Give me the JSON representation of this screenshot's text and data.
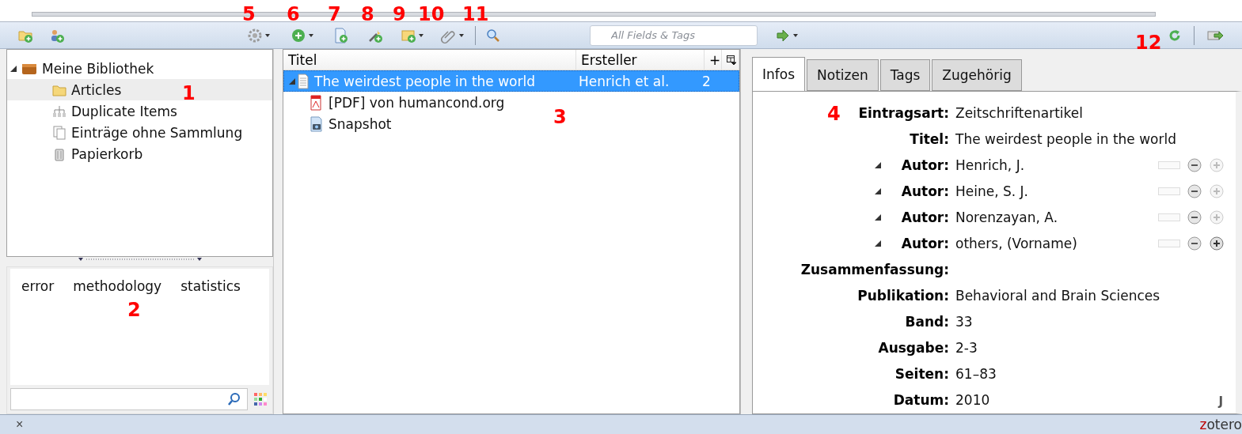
{
  "toolbar": {
    "search": {
      "placeholder": "All Fields & Tags"
    }
  },
  "collections": [
    {
      "label": "Meine Bibliothek",
      "kind": "library",
      "expanded": true,
      "selected": false,
      "children": [
        {
          "label": "Articles",
          "kind": "folder",
          "selected": true
        },
        {
          "label": "Duplicate Items",
          "kind": "duplicates",
          "selected": false
        },
        {
          "label": "Einträge ohne Sammlung",
          "kind": "unfiled",
          "selected": false
        },
        {
          "label": "Papierkorb",
          "kind": "trash",
          "selected": false
        }
      ]
    }
  ],
  "tags": [
    "error",
    "methodology",
    "statistics"
  ],
  "items": {
    "columns": [
      "Titel",
      "Ersteller",
      "+"
    ],
    "rows": [
      {
        "title": "The weirdest people in the world",
        "creator": "Henrich et al.",
        "column_3": "2",
        "kind": "article",
        "expanded": true,
        "selected": true,
        "children": [
          {
            "title": "[PDF] von humancond.org",
            "kind": "pdf",
            "selected": false
          },
          {
            "title": "Snapshot",
            "kind": "snapshot",
            "selected": false
          }
        ]
      }
    ]
  },
  "tabs": [
    {
      "label": "Infos",
      "selected": true
    },
    {
      "label": "Notizen",
      "selected": false
    },
    {
      "label": "Tags",
      "selected": false
    },
    {
      "label": "Zugehörig",
      "selected": false
    }
  ],
  "fields": [
    {
      "label": "Eintragsart:",
      "value": "Zeitschriftenartikel",
      "kind": "plain"
    },
    {
      "label": "Titel:",
      "value": "The weirdest people in the world",
      "kind": "plain"
    },
    {
      "label": "Autor:",
      "value": "Henrich, J.",
      "kind": "creator",
      "add_enabled": false
    },
    {
      "label": "Autor:",
      "value": "Heine, S. J.",
      "kind": "creator",
      "add_enabled": false
    },
    {
      "label": "Autor:",
      "value": "Norenzayan, A.",
      "kind": "creator",
      "add_enabled": false
    },
    {
      "label": "Autor:",
      "value": "others, (Vorname)",
      "kind": "creator",
      "add_enabled": true
    },
    {
      "label": "Zusammenfassung:",
      "kind": "plain"
    },
    {
      "label": "Publikation:",
      "value": "Behavioral and Brain Sciences",
      "kind": "plain"
    },
    {
      "label": "Band:",
      "value": "33",
      "kind": "plain"
    },
    {
      "label": "Ausgabe:",
      "value": "2-3",
      "kind": "plain"
    },
    {
      "label": "Seiten:",
      "value": "61–83",
      "kind": "plain"
    },
    {
      "label": "Datum:",
      "value": "2010",
      "kind": "plain"
    }
  ],
  "panel_corner_text": "J",
  "status_bar": {
    "close": "×",
    "logo": "zotero"
  },
  "annotations": [
    "1",
    "2",
    "3",
    "4",
    "5",
    "6",
    "7",
    "8",
    "9",
    "10",
    "11",
    "12"
  ]
}
